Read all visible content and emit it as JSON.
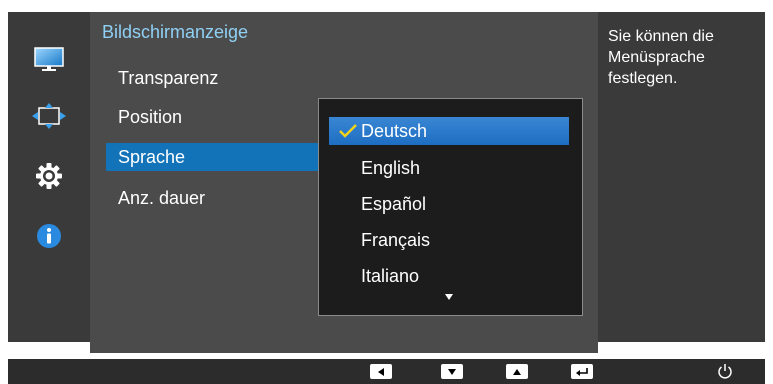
{
  "menu": {
    "title": "Bildschirmanzeige",
    "items": [
      {
        "label": "Transparenz"
      },
      {
        "label": "Position"
      },
      {
        "label": "Sprache",
        "selected": true
      },
      {
        "label": "Anz. dauer"
      }
    ]
  },
  "side_icons": [
    {
      "name": "picture-icon"
    },
    {
      "name": "position-size-icon"
    },
    {
      "name": "settings-gear-icon"
    },
    {
      "name": "info-icon"
    }
  ],
  "language_dropdown": {
    "options": [
      "Deutsch",
      "English",
      "Español",
      "Français",
      "Italiano"
    ],
    "selected": "Deutsch"
  },
  "help": {
    "text": "Sie können die Menüsprache festlegen."
  },
  "colors": {
    "panel_bg": "#4b4b4b",
    "title": "#8fd0f5",
    "selection": "#1273b8",
    "dropdown_bg": "#1c1c1c",
    "dark_bg": "#3a3a3a"
  },
  "bottom_keys": [
    "left-key",
    "down-key",
    "up-key",
    "enter-key",
    "power-button"
  ]
}
